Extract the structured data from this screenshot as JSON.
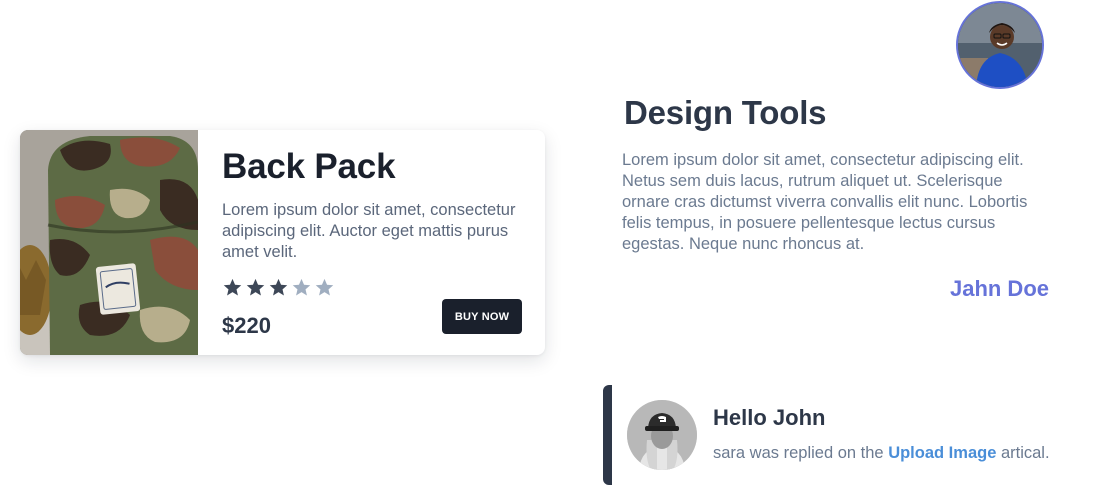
{
  "product": {
    "title": "Back Pack",
    "description": "Lorem ipsum dolor sit amet, consectetur adipiscing elit. Auctor eget mattis purus amet velit.",
    "rating": 3,
    "rating_max": 5,
    "price": "$220",
    "buy_label": "BUY NOW",
    "image_alt": "Camouflage backpack photo",
    "colors": {
      "star_filled": "#3d4757",
      "star_empty": "#a0aec0",
      "button": "#1a202c"
    }
  },
  "testimonial": {
    "title": "Design Tools",
    "text": "Lorem ipsum dolor sit amet, consectetur adipiscing elit. Netus sem duis lacus, rutrum aliquet ut. Scelerisque ornare cras dictumst viverra convallis elit nunc. Lobortis felis tempus, in posuere pellentesque lectus cursus egestas. Neque nunc rhoncus at.",
    "author": "Jahn Doe",
    "avatar_alt": "Smiling man in blue jacket",
    "colors": {
      "accent": "#6673d9"
    }
  },
  "notification": {
    "title": "Hello John",
    "message_prefix": "sara was replied on the ",
    "link_text": "Upload Image",
    "message_suffix": " artical.",
    "avatar_alt": "Woman in black cap",
    "colors": {
      "bar": "#2d3748",
      "link": "#4a8ed8"
    }
  }
}
